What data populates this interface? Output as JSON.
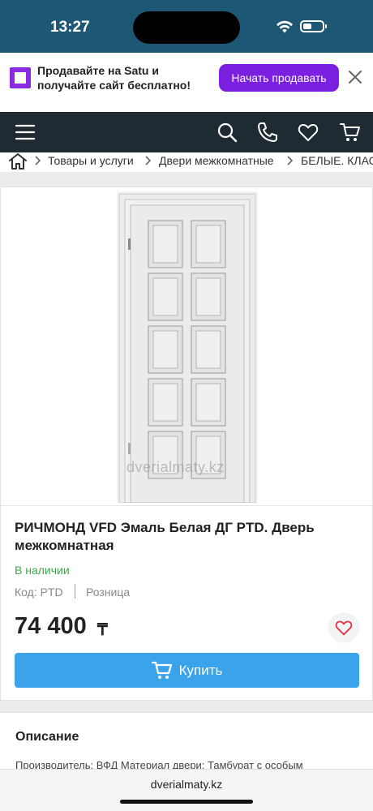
{
  "status_bar": {
    "time": "13:27"
  },
  "promo": {
    "text": "Продавайте на Satu и получайте сайт бесплатно!",
    "button_label": "Начать продавать"
  },
  "breadcrumb": {
    "items": [
      "Товары и услуги",
      "Двери межкомнатные",
      "БЕЛЫЕ. КЛАССИКА"
    ]
  },
  "product": {
    "watermark": "dverialmaty.kz",
    "title": "РИЧМОНД VFD Эмаль Белая ДГ PTD. Дверь межкомнатная",
    "stock_status": "В наличии",
    "code": "Код: PTD",
    "sale_type": "Розница",
    "price": "74 400",
    "currency": "₸",
    "buy_label": "Купить"
  },
  "description": {
    "title": "Описание",
    "text": "Производитель: ВФД Материал двери: Тамбурат с особым"
  },
  "browser": {
    "url": "dverialmaty.kz"
  },
  "colors": {
    "status_bar": "#1e5774",
    "header": "#1e2b33",
    "promo_accent": "#7b1fe0",
    "buy_button": "#3aa3ea",
    "in_stock": "#3aa84a"
  }
}
